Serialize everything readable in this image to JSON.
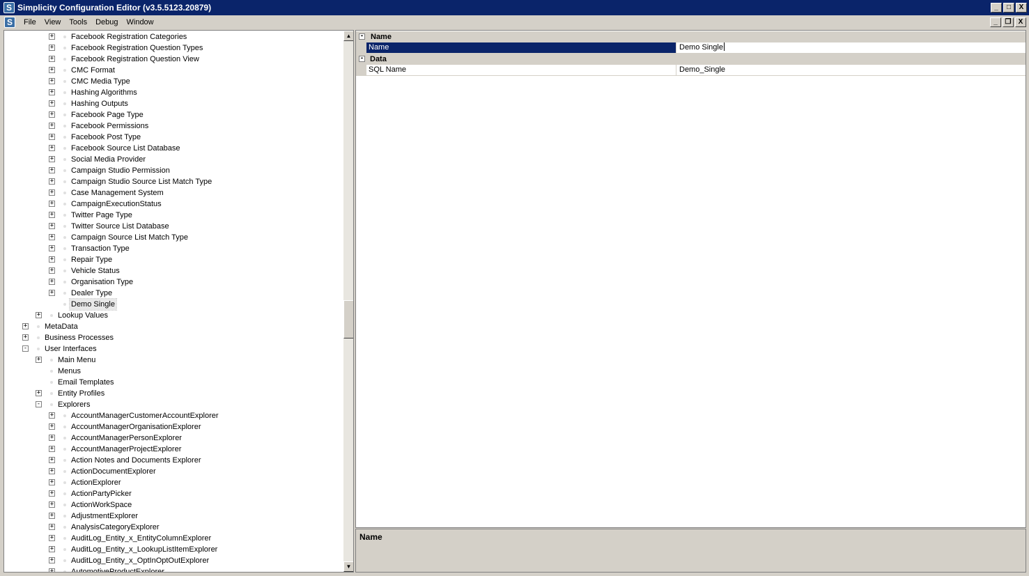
{
  "window": {
    "title": "Simplicity Configuration Editor (v3.5.5123.20879)",
    "icon_letter": "S",
    "controls": [
      "_",
      "□",
      "X"
    ]
  },
  "menubar": {
    "items": [
      "File",
      "View",
      "Tools",
      "Debug",
      "Window"
    ],
    "mdi_controls": [
      "_",
      "❐",
      "X"
    ]
  },
  "tree": {
    "nodes": [
      {
        "label": "Facebook Registration Categories",
        "level": 3,
        "expander": "+"
      },
      {
        "label": "Facebook Registration Question Types",
        "level": 3,
        "expander": "+"
      },
      {
        "label": "Facebook Registration Question View",
        "level": 3,
        "expander": "+"
      },
      {
        "label": "CMC Format",
        "level": 3,
        "expander": "+"
      },
      {
        "label": "CMC Media Type",
        "level": 3,
        "expander": "+"
      },
      {
        "label": "Hashing Algorithms",
        "level": 3,
        "expander": "+"
      },
      {
        "label": "Hashing Outputs",
        "level": 3,
        "expander": "+"
      },
      {
        "label": "Facebook Page Type",
        "level": 3,
        "expander": "+"
      },
      {
        "label": "Facebook Permissions",
        "level": 3,
        "expander": "+"
      },
      {
        "label": "Facebook Post Type",
        "level": 3,
        "expander": "+"
      },
      {
        "label": "Facebook Source List Database",
        "level": 3,
        "expander": "+"
      },
      {
        "label": "Social Media Provider",
        "level": 3,
        "expander": "+"
      },
      {
        "label": "Campaign Studio Permission",
        "level": 3,
        "expander": "+"
      },
      {
        "label": "Campaign Studio Source List Match Type",
        "level": 3,
        "expander": "+"
      },
      {
        "label": "Case Management System",
        "level": 3,
        "expander": "+"
      },
      {
        "label": "CampaignExecutionStatus",
        "level": 3,
        "expander": "+"
      },
      {
        "label": "Twitter Page Type",
        "level": 3,
        "expander": "+"
      },
      {
        "label": "Twitter Source List Database",
        "level": 3,
        "expander": "+"
      },
      {
        "label": "Campaign Source List Match Type",
        "level": 3,
        "expander": "+"
      },
      {
        "label": "Transaction Type",
        "level": 3,
        "expander": "+"
      },
      {
        "label": "Repair Type",
        "level": 3,
        "expander": "+"
      },
      {
        "label": "Vehicle Status",
        "level": 3,
        "expander": "+"
      },
      {
        "label": "Organisation Type",
        "level": 3,
        "expander": "+"
      },
      {
        "label": "Dealer Type",
        "level": 3,
        "expander": "+"
      },
      {
        "label": "Demo Single",
        "level": 3,
        "expander": "",
        "selected": true
      },
      {
        "label": "Lookup Values",
        "level": 2,
        "expander": "+"
      },
      {
        "label": "MetaData",
        "level": 1,
        "expander": "+"
      },
      {
        "label": "Business Processes",
        "level": 1,
        "expander": "+"
      },
      {
        "label": "User Interfaces",
        "level": 1,
        "expander": "-"
      },
      {
        "label": "Main Menu",
        "level": 2,
        "expander": "+"
      },
      {
        "label": "Menus",
        "level": 2,
        "expander": ""
      },
      {
        "label": "Email Templates",
        "level": 2,
        "expander": ""
      },
      {
        "label": "Entity Profiles",
        "level": 2,
        "expander": "+"
      },
      {
        "label": "Explorers",
        "level": 2,
        "expander": "-"
      },
      {
        "label": "AccountManagerCustomerAccountExplorer",
        "level": 3,
        "expander": "+"
      },
      {
        "label": "AccountManagerOrganisationExplorer",
        "level": 3,
        "expander": "+"
      },
      {
        "label": "AccountManagerPersonExplorer",
        "level": 3,
        "expander": "+"
      },
      {
        "label": "AccountManagerProjectExplorer",
        "level": 3,
        "expander": "+"
      },
      {
        "label": "Action Notes and Documents Explorer",
        "level": 3,
        "expander": "+"
      },
      {
        "label": "ActionDocumentExplorer",
        "level": 3,
        "expander": "+"
      },
      {
        "label": "ActionExplorer",
        "level": 3,
        "expander": "+"
      },
      {
        "label": "ActionPartyPicker",
        "level": 3,
        "expander": "+"
      },
      {
        "label": "ActionWorkSpace",
        "level": 3,
        "expander": "+"
      },
      {
        "label": "AdjustmentExplorer",
        "level": 3,
        "expander": "+"
      },
      {
        "label": "AnalysisCategoryExplorer",
        "level": 3,
        "expander": "+"
      },
      {
        "label": "AuditLog_Entity_x_EntityColumnExplorer",
        "level": 3,
        "expander": "+"
      },
      {
        "label": "AuditLog_Entity_x_LookupListItemExplorer",
        "level": 3,
        "expander": "+"
      },
      {
        "label": "AuditLog_Entity_x_OptInOptOutExplorer",
        "level": 3,
        "expander": "+"
      },
      {
        "label": "AutomotiveProductExplorer",
        "level": 3,
        "expander": "+"
      }
    ]
  },
  "scrollbar": {
    "up": "▲",
    "down": "▼"
  },
  "property_grid": {
    "categories": [
      {
        "name": "Name",
        "expander": "-",
        "rows": [
          {
            "name": "Name",
            "value": "Demo Single",
            "selected": true
          }
        ]
      },
      {
        "name": "Data",
        "expander": "-",
        "rows": [
          {
            "name": "SQL Name",
            "value": "Demo_Single",
            "selected": false
          }
        ]
      }
    ]
  },
  "help_pane": {
    "title": "Name",
    "description": ""
  },
  "colors": {
    "titlebar": "#0a246a",
    "selection": "#0a246a",
    "chrome": "#d4d0c8"
  }
}
